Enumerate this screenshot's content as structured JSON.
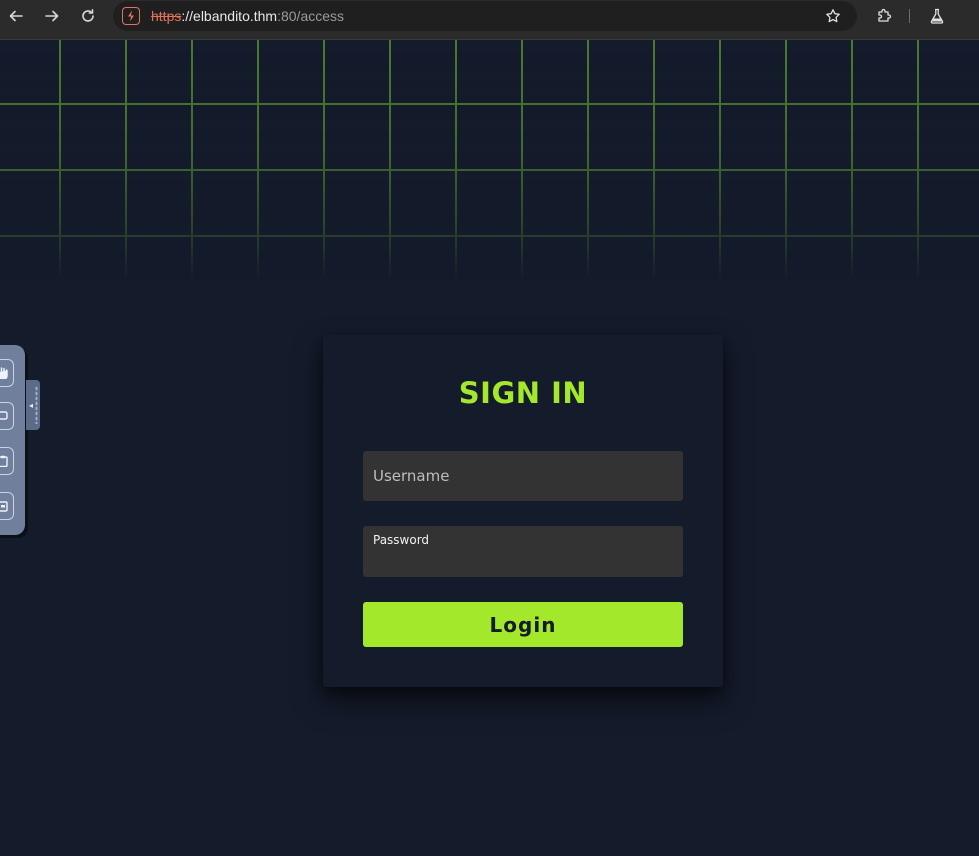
{
  "browser": {
    "url_scheme": "https",
    "url_rest": "://elbandito.thm",
    "url_port": ":80/access",
    "icons": [
      "back-arrow-icon",
      "forward-arrow-icon",
      "reload-icon",
      "insecure-site-icon",
      "bookmark-star-icon",
      "extensions-puzzle-icon",
      "labs-flask-icon"
    ]
  },
  "side_panel": {
    "icons": [
      "hand-icon",
      "screen-icon",
      "clipboard-icon",
      "calendar-icon"
    ],
    "handle_glyph": "◂"
  },
  "login": {
    "title": "SIGN IN",
    "username_placeholder": "Username",
    "password_label": "Password",
    "password_value": "",
    "button_label": "Login"
  },
  "colors": {
    "accent": "#a3e82b",
    "background": "#141b2b",
    "field_bg": "#333333",
    "grid_line": "#4a7a2e",
    "insecure": "#e2725b"
  }
}
